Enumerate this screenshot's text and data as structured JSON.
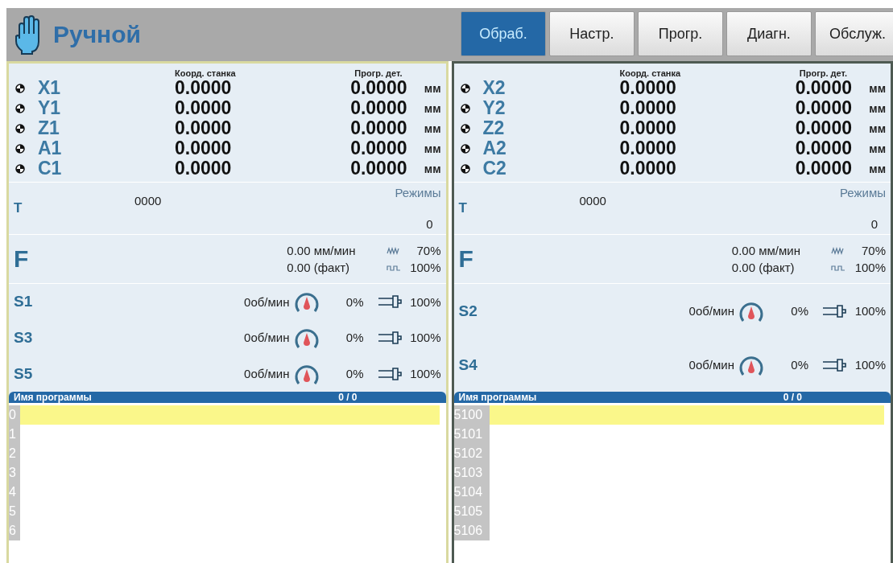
{
  "mode": {
    "title": "Ручной"
  },
  "tabs": [
    {
      "label": "Обраб.",
      "selected": true
    },
    {
      "label": "Настр.",
      "selected": false
    },
    {
      "label": "Прогр.",
      "selected": false
    },
    {
      "label": "Диагн.",
      "selected": false
    },
    {
      "label": "Обслуж.",
      "selected": false
    }
  ],
  "channels": [
    {
      "selected": true,
      "axes_header": {
        "machine": "Коорд. станка",
        "program": "Прогр. дет."
      },
      "axes": [
        {
          "name": "X1",
          "machine": "0.0000",
          "program": "0.0000",
          "unit": "мм"
        },
        {
          "name": "Y1",
          "machine": "0.0000",
          "program": "0.0000",
          "unit": "мм"
        },
        {
          "name": "Z1",
          "machine": "0.0000",
          "program": "0.0000",
          "unit": "мм"
        },
        {
          "name": "A1",
          "machine": "0.0000",
          "program": "0.0000",
          "unit": "мм"
        },
        {
          "name": "C1",
          "machine": "0.0000",
          "program": "0.0000",
          "unit": "мм"
        }
      ],
      "tool": {
        "label": "T",
        "value": "0000",
        "modes_label": "Режимы",
        "modes_value": "0"
      },
      "feed": {
        "label": "F",
        "rate": "0.00 мм/мин",
        "actual": "0.00 (факт)",
        "rapid_override": "70%",
        "feed_override": "100%"
      },
      "spindles": [
        {
          "name": "S1",
          "speed": "0об/мин",
          "load": "0%",
          "override": "100%"
        },
        {
          "name": "S3",
          "speed": "0об/мин",
          "load": "0%",
          "override": "100%"
        },
        {
          "name": "S5",
          "speed": "0об/мин",
          "load": "0%",
          "override": "100%"
        }
      ],
      "program": {
        "header": "Имя программы",
        "count": "0 / 0",
        "lines": [
          {
            "number": "0",
            "selected": true
          },
          {
            "number": "1",
            "selected": false
          },
          {
            "number": "2",
            "selected": false
          },
          {
            "number": "3",
            "selected": false
          },
          {
            "number": "4",
            "selected": false
          },
          {
            "number": "5",
            "selected": false
          },
          {
            "number": "6",
            "selected": false
          }
        ]
      }
    },
    {
      "selected": false,
      "axes_header": {
        "machine": "Коорд. станка",
        "program": "Прогр. дет."
      },
      "axes": [
        {
          "name": "X2",
          "machine": "0.0000",
          "program": "0.0000",
          "unit": "мм"
        },
        {
          "name": "Y2",
          "machine": "0.0000",
          "program": "0.0000",
          "unit": "мм"
        },
        {
          "name": "Z2",
          "machine": "0.0000",
          "program": "0.0000",
          "unit": "мм"
        },
        {
          "name": "A2",
          "machine": "0.0000",
          "program": "0.0000",
          "unit": "мм"
        },
        {
          "name": "C2",
          "machine": "0.0000",
          "program": "0.0000",
          "unit": "мм"
        }
      ],
      "tool": {
        "label": "T",
        "value": "0000",
        "modes_label": "Режимы",
        "modes_value": "0"
      },
      "feed": {
        "label": "F",
        "rate": "0.00 мм/мин",
        "actual": "0.00 (факт)",
        "rapid_override": "70%",
        "feed_override": "100%"
      },
      "spindles": [
        {
          "name": "S2",
          "speed": "0об/мин",
          "load": "0%",
          "override": "100%"
        },
        {
          "name": "S4",
          "speed": "0об/мин",
          "load": "0%",
          "override": "100%"
        }
      ],
      "program": {
        "header": "Имя программы",
        "count": "0 / 0",
        "lines": [
          {
            "number": "5100",
            "selected": true
          },
          {
            "number": "5101",
            "selected": false
          },
          {
            "number": "5102",
            "selected": false
          },
          {
            "number": "5103",
            "selected": false
          },
          {
            "number": "5104",
            "selected": false
          },
          {
            "number": "5105",
            "selected": false
          },
          {
            "number": "5106",
            "selected": false
          }
        ]
      }
    }
  ]
}
